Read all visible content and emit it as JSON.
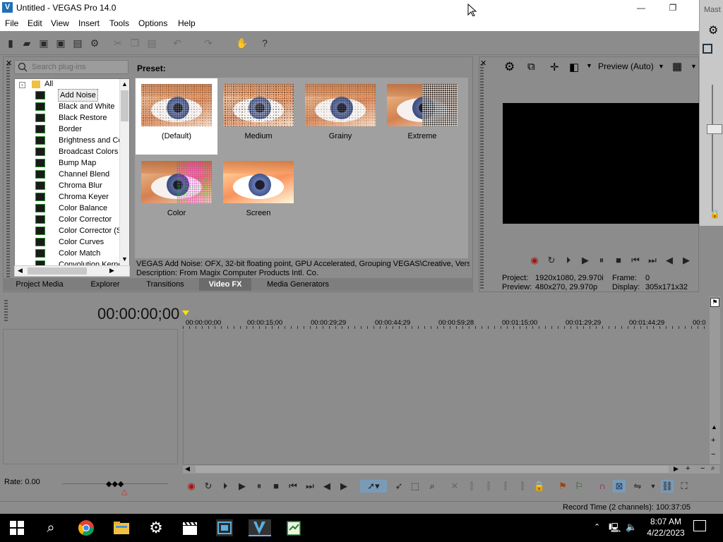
{
  "window": {
    "title": "Untitled - VEGAS Pro 14.0",
    "app_icon": "V",
    "minimize": "—",
    "restore": "❐"
  },
  "menu": [
    "File",
    "Edit",
    "View",
    "Insert",
    "Tools",
    "Options",
    "Help"
  ],
  "mast_window": {
    "title": "Mast"
  },
  "plugin_search": {
    "placeholder": "Search plug-ins"
  },
  "tree": {
    "root": "All",
    "items": [
      "Add Noise",
      "Black and White",
      "Black Restore",
      "Border",
      "Brightness and Co",
      "Broadcast Colors",
      "Bump Map",
      "Channel Blend",
      "Chroma Blur",
      "Chroma Keyer",
      "Color Balance",
      "Color Corrector",
      "Color Corrector (S",
      "Color Curves",
      "Color Match",
      "Convolution Kerne"
    ],
    "selected": "Add Noise"
  },
  "preset": {
    "label": "Preset:",
    "items": [
      "(Default)",
      "Medium",
      "Grainy",
      "Extreme",
      "Color",
      "Screen"
    ],
    "selected": "(Default)"
  },
  "fx_description": {
    "line1": "VEGAS Add Noise: OFX, 32-bit floating point, GPU Accelerated, Grouping VEGAS\\Creative, Version",
    "line2": "Description: From Magix Computer Products Intl. Co."
  },
  "tabs": [
    "Project Media",
    "Explorer",
    "Transitions",
    "Video FX",
    "Media Generators"
  ],
  "active_tab": "Video FX",
  "preview": {
    "mode": "Preview (Auto)",
    "project_label": "Project:",
    "project_value": "1920x1080, 29.970i",
    "frame_label": "Frame:",
    "frame_value": "0",
    "preview_label": "Preview:",
    "preview_value": "480x270, 29.970p",
    "display_label": "Display:",
    "display_value": "305x171x32"
  },
  "timeline": {
    "timecode": "00:00:00;00",
    "ruler": [
      "00:00:00;00",
      "00:00:15;00",
      "00:00:29;29",
      "00:00:44;29",
      "00:00:59;28",
      "00:01:15;00",
      "00:01:29;29",
      "00:01:44;29",
      "00:0"
    ],
    "rate": "Rate: 0.00"
  },
  "status": {
    "record_time": "Record Time (2 channels): 100:37:05"
  },
  "taskbar": {
    "time": "8:07 AM",
    "date": "4/22/2023"
  },
  "colors": {
    "panel": "#8c8c8c",
    "active_tab": "#6b6b6b",
    "preview_bg": "#000000",
    "taskbar": "#000000",
    "selection": "#ececec"
  }
}
